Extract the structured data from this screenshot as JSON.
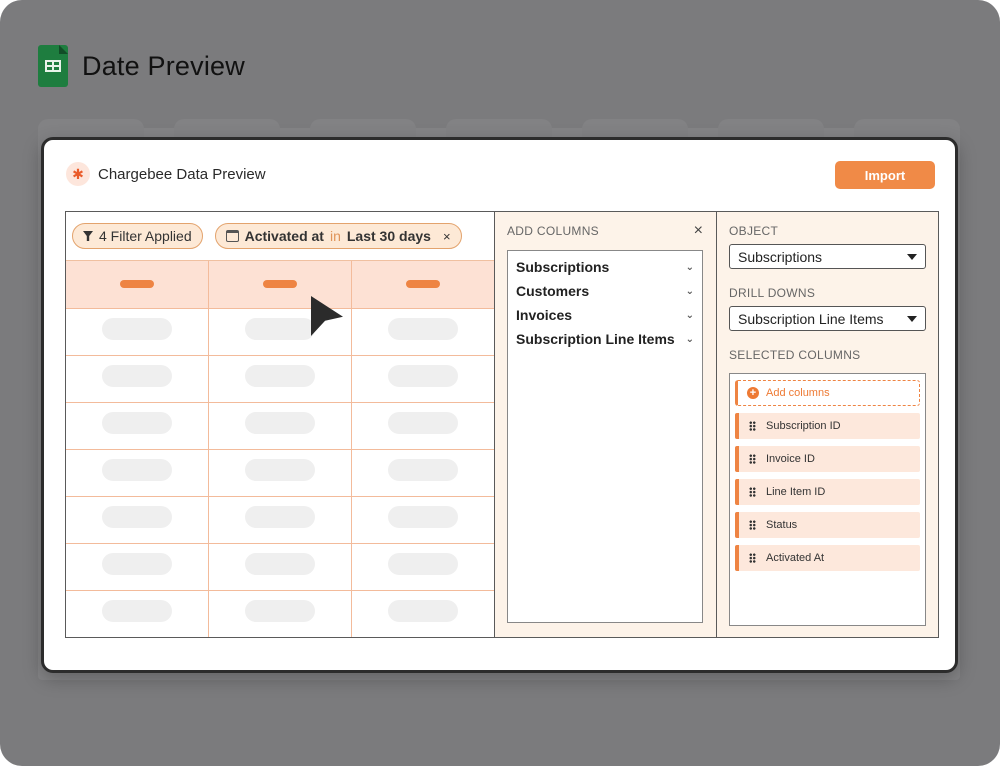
{
  "app": {
    "title": "Date Preview",
    "icon": "google-sheets-icon"
  },
  "modal": {
    "title": "Chargebee Data Preview",
    "logo": "chargebee-logo-icon",
    "import_label": "Import"
  },
  "filters": {
    "count_label": "4 Filter Applied",
    "date_chip": {
      "field": "Activated at",
      "operator": "in",
      "range": "Last 30 days",
      "close": "×"
    }
  },
  "add_columns": {
    "title": "ADD COLUMNS",
    "close": "×",
    "items": [
      "Subscriptions",
      "Customers",
      "Invoices",
      "Subscription Line Items"
    ]
  },
  "config": {
    "object_label": "OBJECT",
    "object_value": "Subscriptions",
    "drilldowns_label": "DRILL DOWNS",
    "drilldowns_value": "Subscription Line Items",
    "selected_label": "SELECTED COLUMNS",
    "add_columns_label": "Add columns",
    "selected_columns": [
      "Subscription ID",
      "Invoice ID",
      "Line Item ID",
      "Status",
      "Activated At"
    ]
  },
  "colors": {
    "accent": "#F08A47",
    "panel_bg": "#FDF3E9",
    "header_cell": "#FDE1D4"
  }
}
